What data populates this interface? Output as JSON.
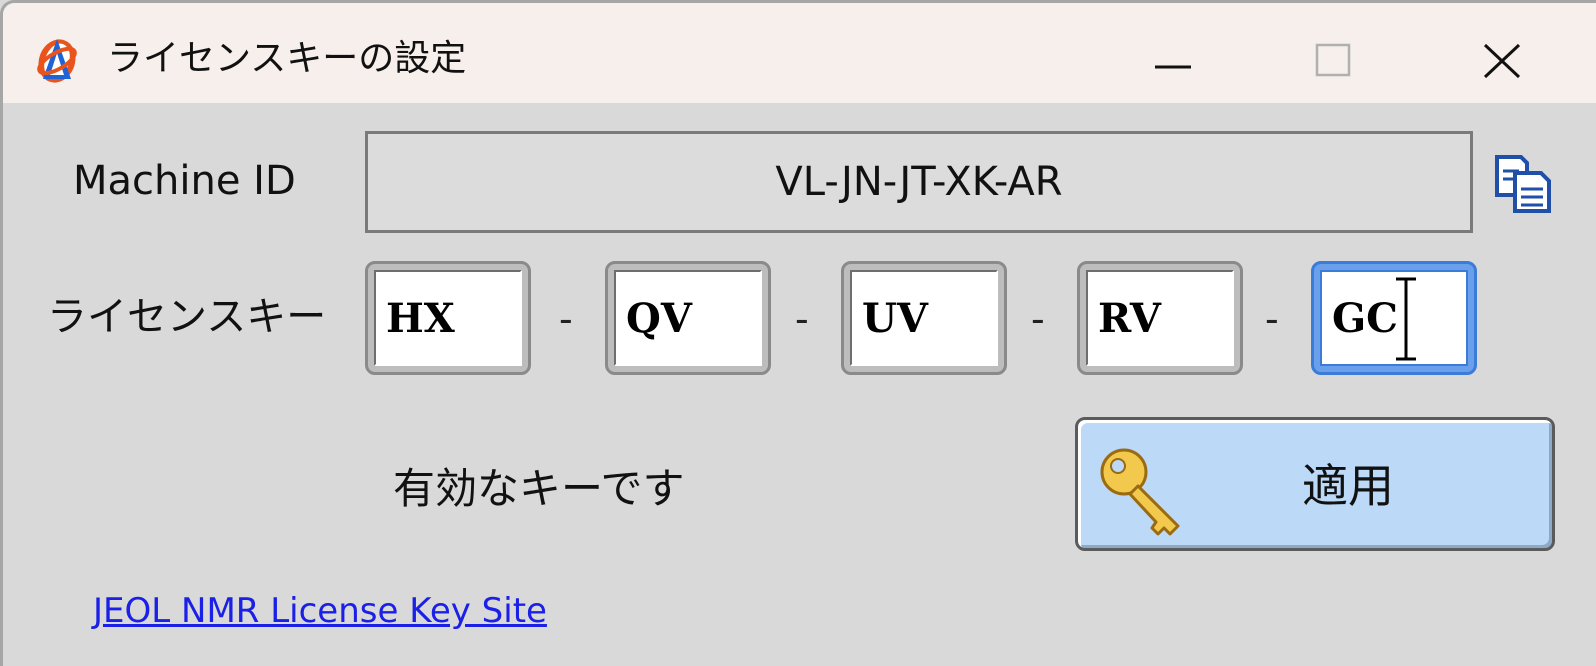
{
  "window": {
    "title": "ライセンスキーの設定",
    "controls": [
      "minimize",
      "maximize",
      "close"
    ]
  },
  "machine_id": {
    "label": "Machine ID",
    "value": "VL-JN-JT-XK-AR"
  },
  "license_key": {
    "label": "ライセンスキー",
    "separator": "-",
    "segments": [
      "HX",
      "QV",
      "UV",
      "RV",
      "GC"
    ],
    "focused_segment": 4
  },
  "status": {
    "text": "有効なキーです"
  },
  "apply": {
    "label": "適用"
  },
  "link": {
    "text": "JEOL NMR License Key Site"
  },
  "icons": {
    "app": "app-logo-icon",
    "copy": "copy-icon",
    "key": "key-icon",
    "cursor": "text-cursor-icon"
  },
  "colors": {
    "titlebar": "#f7efec",
    "background": "#d9d9d9",
    "focus": "#3b7bd9",
    "button": "#bcd9f7",
    "link": "#1a20e6"
  }
}
